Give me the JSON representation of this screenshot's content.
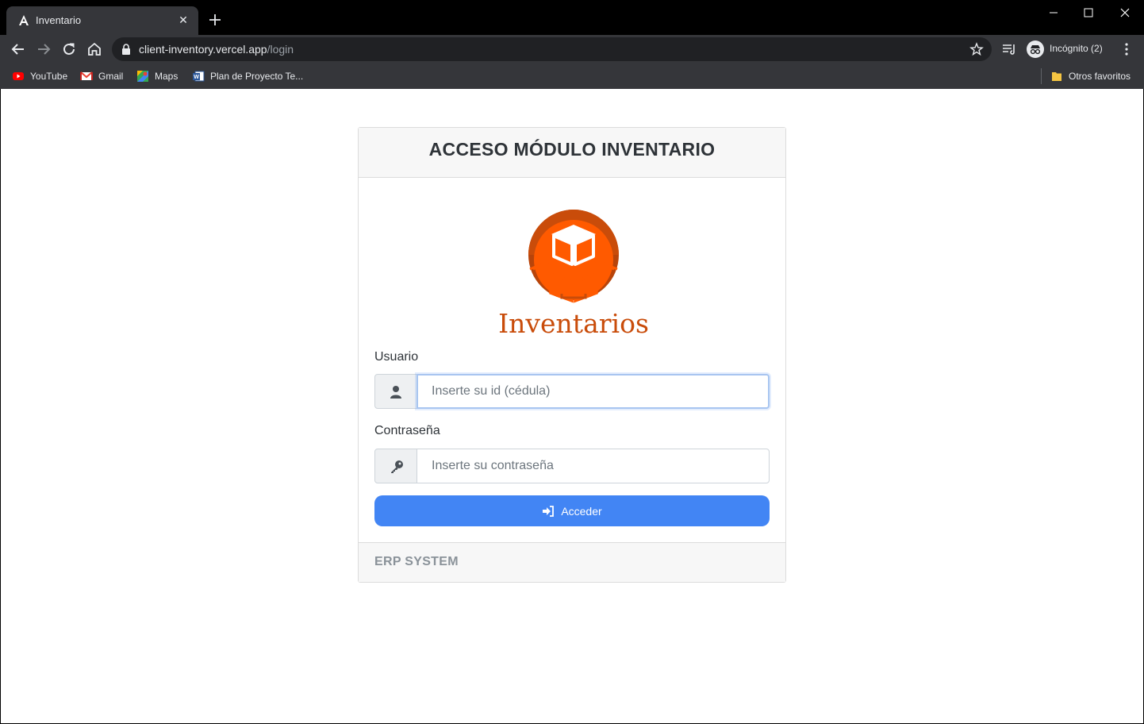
{
  "browser": {
    "tab_title": "Inventario",
    "url_host": "client-inventory.vercel.app",
    "url_path": "/login",
    "profile_label": "Incógnito (2)",
    "bookmarks": [
      "YouTube",
      "Gmail",
      "Maps",
      "Plan de Proyecto Te..."
    ],
    "other_bookmarks": "Otros favoritos"
  },
  "page": {
    "title": "ACCESO MÓDULO INVENTARIO",
    "logo_text": "Inventarios",
    "user_label": "Usuario",
    "user_placeholder": "Inserte su id (cédula)",
    "password_label": "Contraseña",
    "password_placeholder": "Inserte su contraseña",
    "submit_label": "Acceder",
    "footer_text": "ERP SYSTEM"
  },
  "colors": {
    "accent": "#4285f4",
    "brand_orange": "#e05a0c",
    "brand_dark": "#b8440a"
  }
}
